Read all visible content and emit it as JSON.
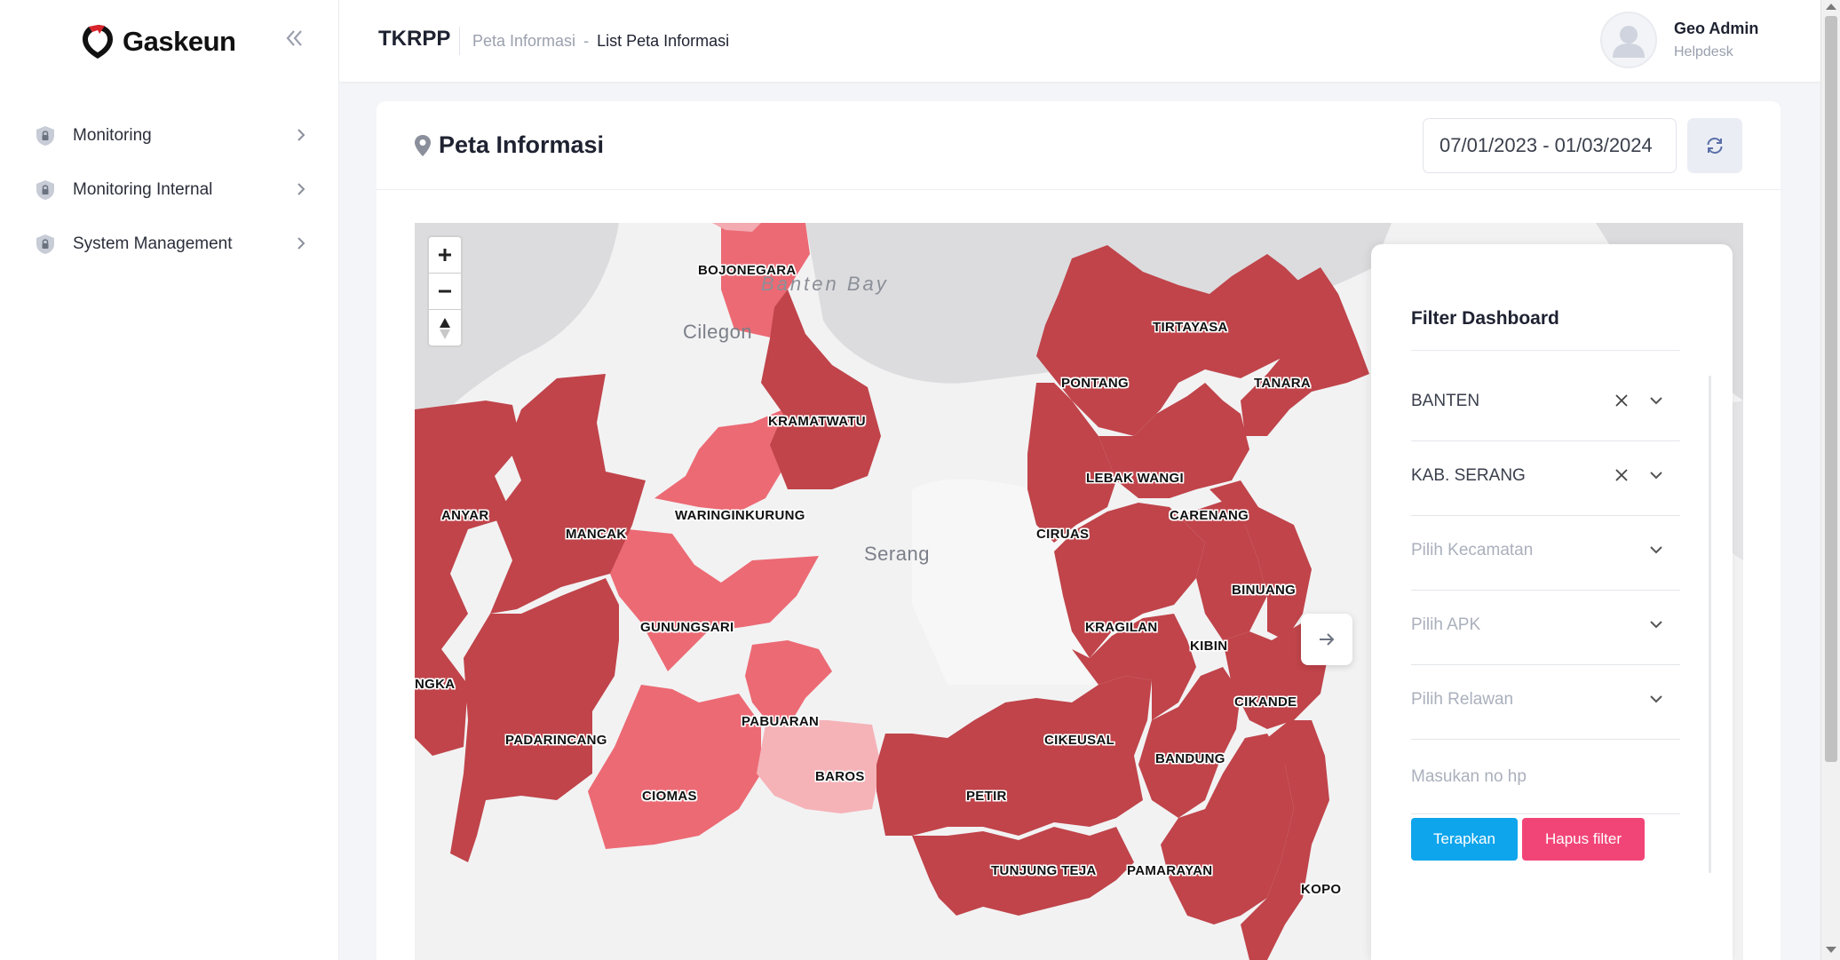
{
  "brand": {
    "name": "Gaskeun"
  },
  "sidebar": {
    "items": [
      {
        "label": "Monitoring"
      },
      {
        "label": "Monitoring Internal"
      },
      {
        "label": "System Management"
      }
    ]
  },
  "header": {
    "title": "TKRPP",
    "breadcrumb": [
      "Peta Informasi",
      "List Peta Informasi"
    ],
    "breadcrumb_separator": "-",
    "user": {
      "name": "Geo Admin",
      "role": "Helpdesk"
    }
  },
  "card": {
    "title": "Peta Informasi",
    "date_range": "07/01/2023 - 01/03/2024"
  },
  "map": {
    "places": [
      "Banten Bay",
      "Cilegon",
      "Serang"
    ],
    "districts": [
      {
        "name": "BOJONEGARA",
        "level": "medium"
      },
      {
        "name": "KRAMATWATU",
        "level": "high"
      },
      {
        "name": "ANYAR",
        "level": "high"
      },
      {
        "name": "MANCAK",
        "level": "high"
      },
      {
        "name": "WARINGINKURUNG",
        "level": "medium"
      },
      {
        "name": "GUNUNGSARI",
        "level": "medium"
      },
      {
        "name": "NGKA",
        "level": "high"
      },
      {
        "name": "PADARINCANG",
        "level": "high"
      },
      {
        "name": "PABUARAN",
        "level": "medium"
      },
      {
        "name": "CIOMAS",
        "level": "medium"
      },
      {
        "name": "BAROS",
        "level": "low"
      },
      {
        "name": "TIRTAYASA",
        "level": "high"
      },
      {
        "name": "PONTANG",
        "level": "high"
      },
      {
        "name": "TANARA",
        "level": "high"
      },
      {
        "name": "LEBAK WANGI",
        "level": "high"
      },
      {
        "name": "CARENANG",
        "level": "high"
      },
      {
        "name": "CIRUAS",
        "level": "high"
      },
      {
        "name": "BINUANG",
        "level": "high"
      },
      {
        "name": "KRAGILAN",
        "level": "high"
      },
      {
        "name": "KIBIN",
        "level": "high"
      },
      {
        "name": "CIKANDE",
        "level": "high"
      },
      {
        "name": "CIKEUSAL",
        "level": "high"
      },
      {
        "name": "BANDUNG",
        "level": "high"
      },
      {
        "name": "PETIR",
        "level": "high"
      },
      {
        "name": "TUNJUNG TEJA",
        "level": "high"
      },
      {
        "name": "PAMARAYAN",
        "level": "high"
      },
      {
        "name": "KOPO",
        "level": "high"
      }
    ],
    "colors": {
      "high": "#c0444a",
      "medium": "#ec6a74",
      "low": "#f5b3b8"
    }
  },
  "filter": {
    "title": "Filter Dashboard",
    "province": "BANTEN",
    "regency": "KAB. SERANG",
    "kecamatan_placeholder": "Pilih Kecamatan",
    "apk_placeholder": "Pilih APK",
    "relawan_placeholder": "Pilih Relawan",
    "phone_placeholder": "Masukan no hp",
    "apply_label": "Terapkan",
    "clear_label": "Hapus filter"
  },
  "colors": {
    "accent": "#0ea5ec",
    "danger": "#f24577"
  }
}
